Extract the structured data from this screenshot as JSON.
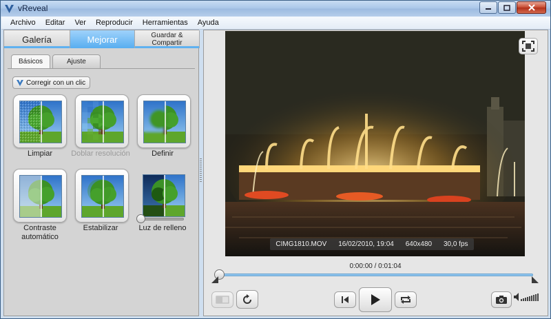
{
  "window": {
    "title": "vReveal"
  },
  "menu": [
    "Archivo",
    "Editar",
    "Ver",
    "Reproducir",
    "Herramientas",
    "Ayuda"
  ],
  "main_tabs": [
    {
      "label": "Galería"
    },
    {
      "label": "Mejorar"
    },
    {
      "label": "Guardar &"
    },
    {
      "label": "Compartir"
    }
  ],
  "sub_tabs": [
    {
      "label": "Básicos"
    },
    {
      "label": "Ajuste"
    }
  ],
  "oneclick_label": "Corregir con un clic",
  "tools": [
    {
      "label": "Limpiar"
    },
    {
      "label": "Doblar resolución"
    },
    {
      "label": "Definir"
    },
    {
      "label": "Contraste automático"
    },
    {
      "label": "Estabilizar"
    },
    {
      "label": "Luz de relleno"
    }
  ],
  "fill_light_level": 0,
  "video_info": {
    "filename": "CIMG1810.MOV",
    "datetime": "16/02/2010, 19:04",
    "resolution": "640x480",
    "fps": "30,0 fps"
  },
  "playback": {
    "current": "0:00:00",
    "separator": " / ",
    "total": "0:01:04",
    "progress": 0
  },
  "colors": {
    "accent": "#5fb1f0",
    "titlebar": "#a9c6e8"
  }
}
